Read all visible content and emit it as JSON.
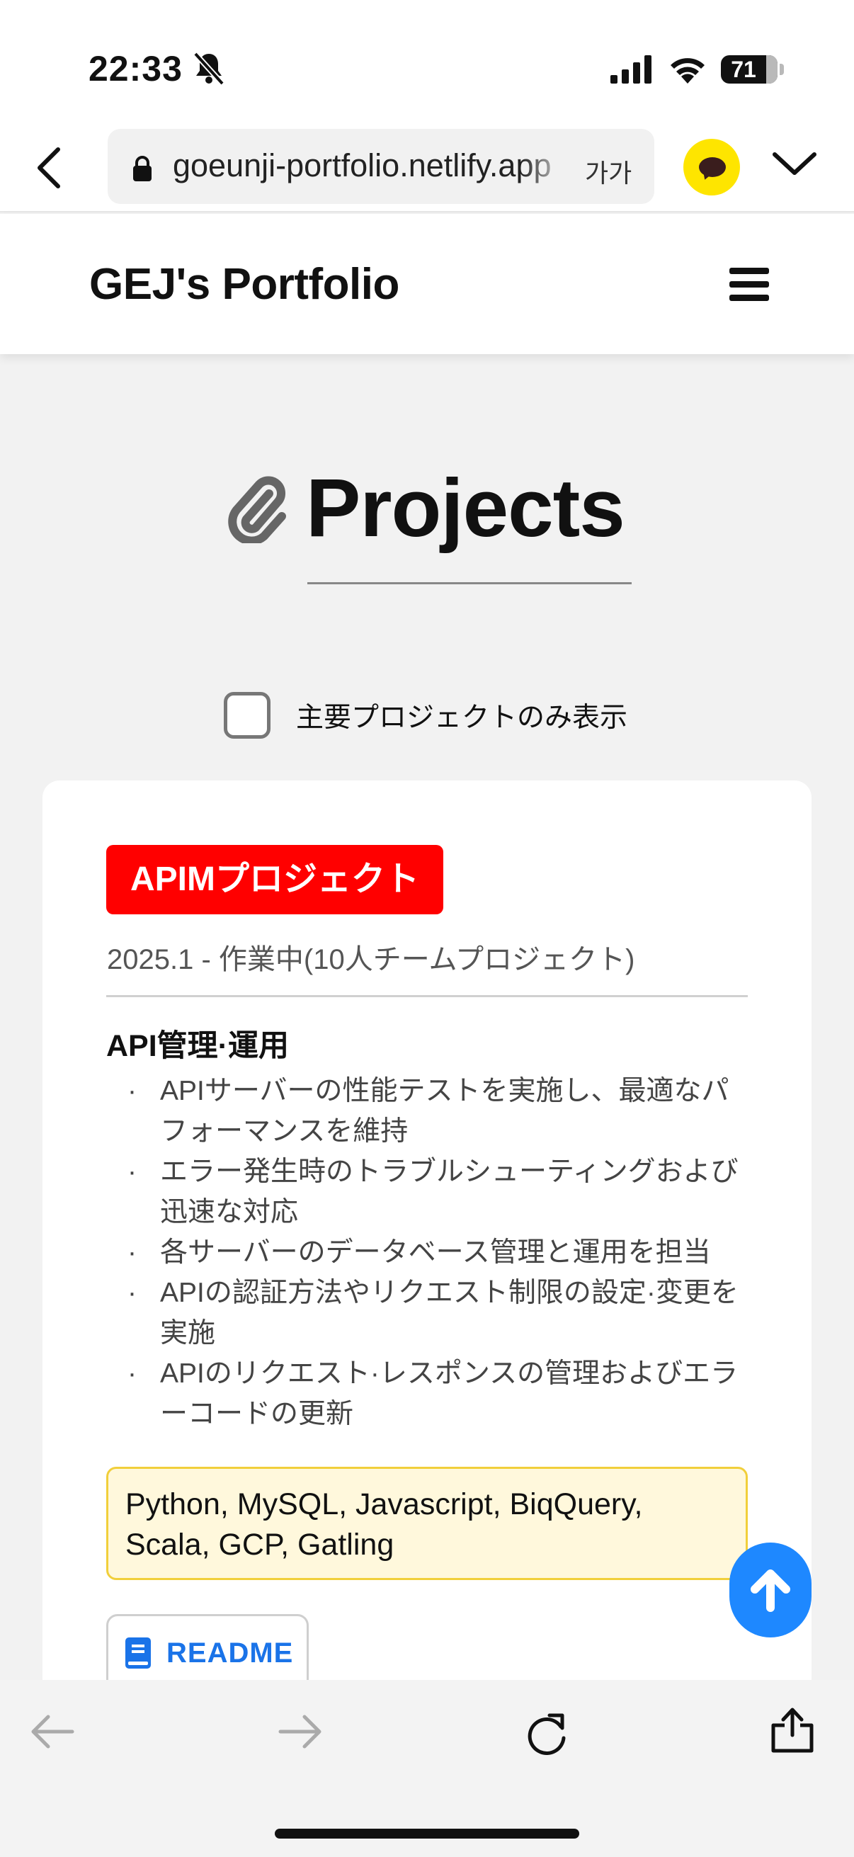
{
  "status_bar": {
    "time": "22:33",
    "battery": "71",
    "icons": [
      "bell-slash-icon",
      "signal-icon",
      "wifi-icon",
      "battery-icon"
    ]
  },
  "browser": {
    "url": "goeunji-portfolio.netlify.app",
    "text_size_label": "가가",
    "icons": [
      "back-chevron-icon",
      "lock-icon",
      "kakaotalk-icon",
      "chevron-down-icon"
    ]
  },
  "site": {
    "brand": "GEJ's Portfolio",
    "menu_icon": "hamburger-icon"
  },
  "section": {
    "icon": "paperclip-icon",
    "title": "Projects",
    "filter_label": "主要プロジェクトのみ表示",
    "filter_checked": false
  },
  "project": {
    "badge": "APIMプロジェクト",
    "badge_color": "#ff0000",
    "period": "2025.1 - 作業中(10人チームプロジェクト)",
    "subheading": "API管理·運用",
    "bullets": [
      "APIサーバーの性能テストを実施し、最適なパフォーマンスを維持",
      "エラー発生時のトラブルシューティングおよび迅速な対応",
      "各サーバーのデータベース管理と運用を担当",
      "APIの認証方法やリクエスト制限の設定·変更を実施",
      "APIのリクエスト·レスポンスの管理およびエラーコードの更新"
    ],
    "tech": "Python, MySQL, Javascript, BiqQuery, Scala, GCP, Gatling",
    "readme_label": "README",
    "readme_color": "#1a73e8"
  },
  "scroll_top": {
    "icon": "arrow-up-icon",
    "color": "#1e88ff"
  },
  "toolbar": {
    "icons": [
      "back-arrow-icon",
      "forward-arrow-icon",
      "reload-icon",
      "share-icon"
    ]
  }
}
